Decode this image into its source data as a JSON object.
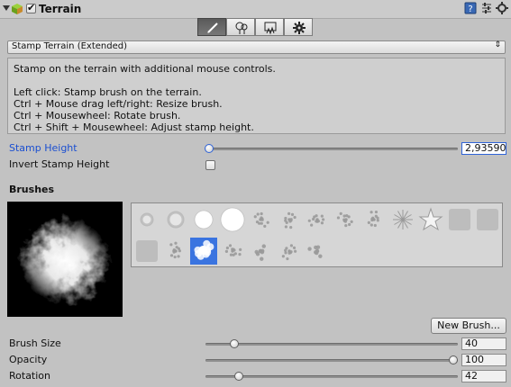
{
  "header": {
    "component_title": "Terrain",
    "enabled": true,
    "icons": [
      "cube-icon",
      "help-book-icon",
      "preset-sliders-icon",
      "gear-icon"
    ]
  },
  "toolbar": {
    "tools": [
      {
        "icon": "paint-brush-icon",
        "active": true
      },
      {
        "icon": "tree-icon",
        "active": false
      },
      {
        "icon": "details-icon",
        "active": false
      },
      {
        "icon": "settings-gear-icon",
        "active": false
      }
    ]
  },
  "tool_select": {
    "value": "Stamp Terrain (Extended)",
    "arrow": "⇕"
  },
  "help": {
    "line1": "Stamp on the terrain with additional mouse controls.",
    "line2": "Left click: Stamp brush on the terrain.",
    "line3": "Ctrl + Mouse drag left/right: Resize brush.",
    "line4": "Ctrl + Mousewheel: Rotate brush.",
    "line5": "Ctrl + Shift + Mousewheel: Adjust stamp height."
  },
  "stamp_height": {
    "label": "Stamp Height",
    "value": "2,93590",
    "fraction": 0.0
  },
  "invert": {
    "label": "Invert Stamp Height",
    "checked": false
  },
  "brushes": {
    "section_title": "Brushes",
    "selected_index": 15,
    "count": 24,
    "new_button": "New Brush..."
  },
  "brush_size": {
    "label": "Brush Size",
    "value": "40",
    "fraction": 0.1
  },
  "opacity": {
    "label": "Opacity",
    "value": "100",
    "fraction": 1.0
  },
  "rotation": {
    "label": "Rotation",
    "value": "42",
    "fraction": 0.12
  },
  "colors": {
    "panel": "#c2c2c2",
    "accent_blue": "#1b4fd1",
    "selection": "#3a74e0"
  }
}
